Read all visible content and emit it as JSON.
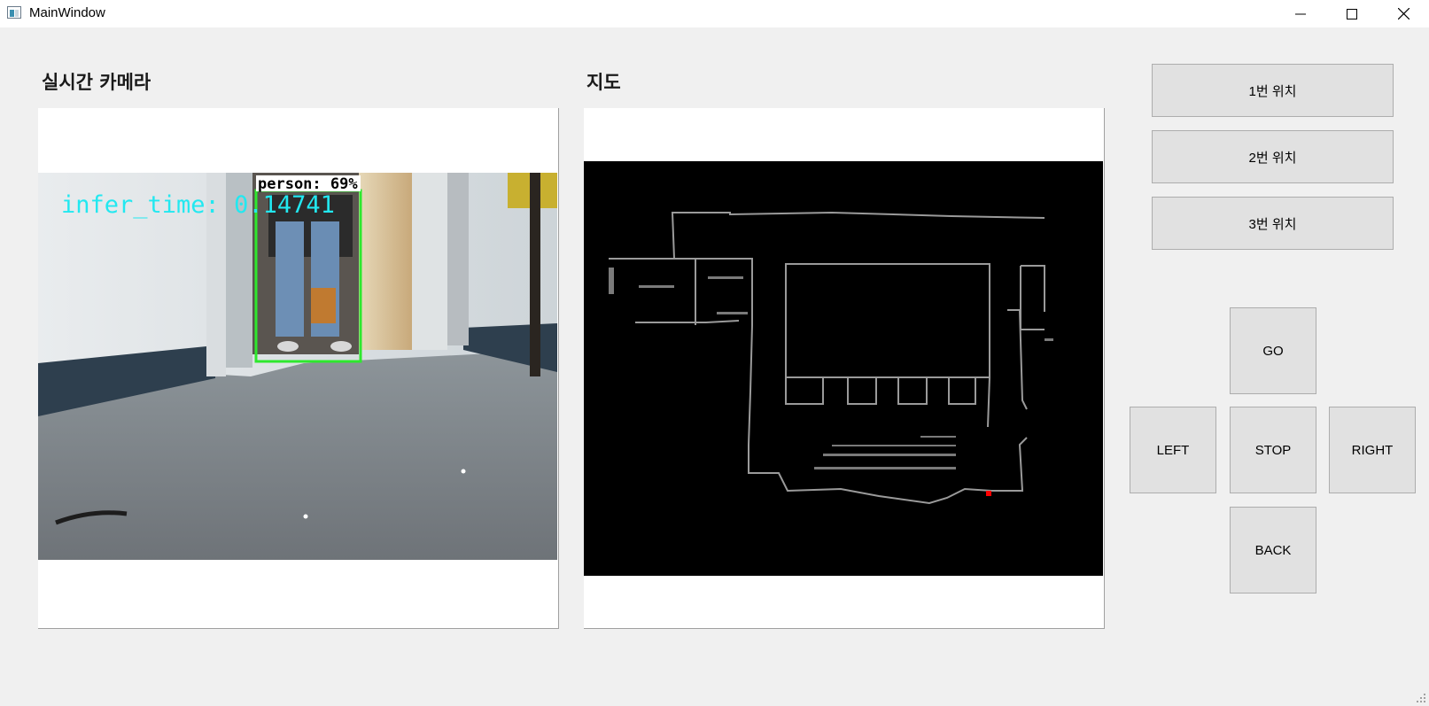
{
  "window": {
    "title": "MainWindow",
    "minimize_icon": "minimize-icon",
    "maximize_icon": "maximize-icon",
    "close_icon": "close-icon"
  },
  "camera": {
    "heading": "실시간 카메라",
    "infer_text": "infer_time: 0.14741",
    "detection_label": "person: 69%"
  },
  "map": {
    "heading": "지도"
  },
  "location_buttons": [
    {
      "label": "1번 위치"
    },
    {
      "label": "2번 위치"
    },
    {
      "label": "3번 위치"
    }
  ],
  "controls": {
    "go": "GO",
    "left": "LEFT",
    "stop": "STOP",
    "right": "RIGHT",
    "back": "BACK"
  },
  "colors": {
    "detection_box": "#2ee82e",
    "infer_text": "#22e8f0",
    "robot_marker": "#ff0000",
    "map_wall": "#9a9a9a"
  }
}
